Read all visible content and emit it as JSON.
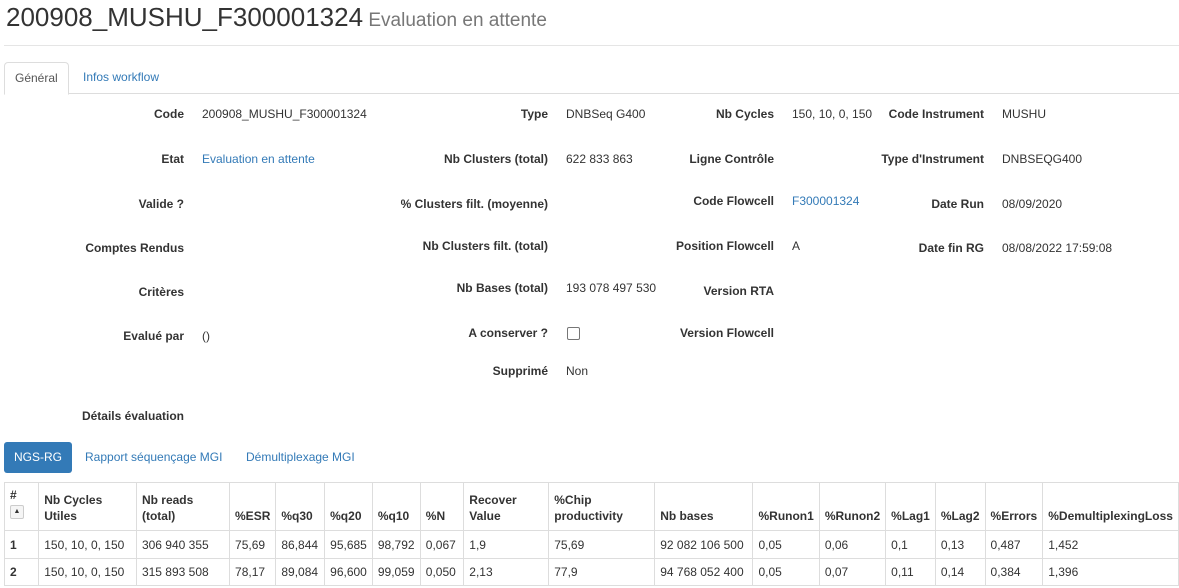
{
  "header": {
    "run_code": "200908_MUSHU_F300001324",
    "status": "Evaluation en attente"
  },
  "tabs": [
    {
      "label": "Général",
      "active": true
    },
    {
      "label": "Infos workflow",
      "active": false
    }
  ],
  "details": {
    "col1": [
      {
        "label": "Code",
        "value": "200908_MUSHU_F300001324"
      },
      {
        "label": "Etat",
        "value": "Evaluation en attente"
      },
      {
        "label": "Valide ?",
        "value": ""
      },
      {
        "label": "Comptes Rendus",
        "value": ""
      },
      {
        "label": "Critères",
        "value": ""
      },
      {
        "label": "Evalué par",
        "value": "()"
      },
      {
        "label": "Détails évaluation",
        "value": ""
      }
    ],
    "col2": [
      {
        "label": "Type",
        "value": "DNBSeq G400"
      },
      {
        "label": "Nb Clusters (total)",
        "value": "622 833 863"
      },
      {
        "label": "% Clusters filt. (moyenne)",
        "value": ""
      },
      {
        "label": "Nb Clusters filt. (total)",
        "value": ""
      },
      {
        "label": "Nb Bases (total)",
        "value": "193 078 497 530"
      },
      {
        "label": "A conserver ?",
        "checked": false
      },
      {
        "label": "Supprimé",
        "value": "Non"
      }
    ],
    "col3": [
      {
        "label": "Nb Cycles",
        "value": "150, 10, 0, 150"
      },
      {
        "label": "Ligne Contrôle",
        "value": ""
      },
      {
        "label": "Code Flowcell",
        "value": "F300001324"
      },
      {
        "label": "Position Flowcell",
        "value": "A"
      },
      {
        "label": "Version RTA",
        "value": ""
      },
      {
        "label": "Version Flowcell",
        "value": ""
      }
    ],
    "col4": [
      {
        "label": "Code Instrument",
        "value": "MUSHU"
      },
      {
        "label": "Type d'Instrument",
        "value": "DNBSEQG400"
      },
      {
        "label": "Date Run",
        "value": "08/09/2020"
      },
      {
        "label": "Date fin RG",
        "value": "08/08/2022 17:59:08"
      }
    ]
  },
  "subtabs": [
    {
      "label": "NGS-RG",
      "active": true
    },
    {
      "label": "Rapport séquençage MGI",
      "active": false
    },
    {
      "label": "Démultiplexage MGI",
      "active": false
    }
  ],
  "table": {
    "columns": [
      "#",
      "Nb Cycles Utiles",
      "Nb reads (total)",
      "%ESR",
      "%q30",
      "%q20",
      "%q10",
      "%N",
      "Recover Value",
      "%Chip productivity",
      "Nb bases",
      "%Runon1",
      "%Runon2",
      "%Lag1",
      "%Lag2",
      "%Errors",
      "%DemultiplexingLoss"
    ],
    "sort_icon": "sort-up-icon",
    "rows": [
      [
        "1",
        "150, 10, 0, 150",
        "306 940 355",
        "75,69",
        "86,844",
        "95,685",
        "98,792",
        "0,067",
        "1,9",
        "75,69",
        "92 082 106 500",
        "0,05",
        "0,06",
        "0,1",
        "0,13",
        "0,487",
        "1,452"
      ],
      [
        "2",
        "150, 10, 0, 150",
        "315 893 508",
        "78,17",
        "89,084",
        "96,600",
        "99,059",
        "0,050",
        "2,13",
        "77,9",
        "94 768 052 400",
        "0,05",
        "0,07",
        "0,11",
        "0,14",
        "0,384",
        "1,396"
      ]
    ]
  },
  "colors": {
    "link": "#337ab7",
    "primary_button": "#337ab7",
    "border": "#dddddd",
    "muted": "#777777"
  }
}
